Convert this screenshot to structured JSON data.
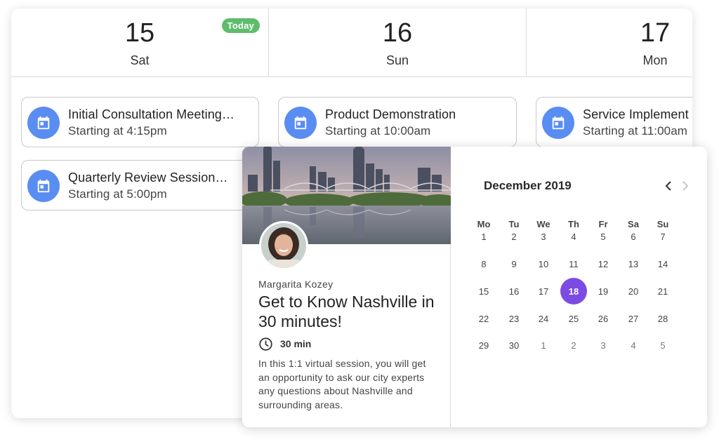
{
  "schedule": {
    "days": [
      {
        "number": "15",
        "name": "Sat",
        "badge": "Today"
      },
      {
        "number": "16",
        "name": "Sun"
      },
      {
        "number": "17",
        "name": "Mon"
      }
    ],
    "events": [
      {
        "title": "Initial Consultation Meeting…",
        "time": "Starting at 4:15pm",
        "icon": "calendar-icon"
      },
      {
        "title": "Quarterly Review Session…",
        "time": "Starting at 5:00pm",
        "icon": "calendar-icon"
      },
      {
        "title": "Product Demonstration",
        "time": "Starting at 10:00am",
        "icon": "calendar-icon"
      },
      {
        "title": "Service Implement",
        "time": "Starting at 11:00am",
        "icon": "calendar-icon"
      }
    ]
  },
  "booking": {
    "host": "Margarita Kozey",
    "title": "Get to Know Nashville in 30 minutes!",
    "duration": "30 min",
    "duration_icon": "clock-icon",
    "description": "In this 1:1 virtual session, you will get an opportunity to ask our city experts any questions about Nashville and surrounding areas."
  },
  "calendar": {
    "month": "December 2019",
    "prev_icon": "chevron-left-icon",
    "next_icon": "chevron-right-icon",
    "weekdays": [
      "Mo",
      "Tu",
      "We",
      "Th",
      "Fr",
      "Sa",
      "Su"
    ],
    "weeks": [
      [
        "1",
        "2",
        "3",
        "4",
        "5",
        "6",
        "7"
      ],
      [
        "8",
        "9",
        "10",
        "11",
        "12",
        "13",
        "14"
      ],
      [
        "15",
        "16",
        "17",
        "18",
        "19",
        "20",
        "21"
      ],
      [
        "22",
        "23",
        "24",
        "25",
        "26",
        "27",
        "28"
      ],
      [
        "29",
        "30",
        "1",
        "2",
        "3",
        "4",
        "5"
      ]
    ],
    "selected": "18"
  },
  "colors": {
    "today_badge": "#5ebc6c",
    "event_icon_bg": "#5a8df2",
    "selected_day": "#7b4be3"
  }
}
